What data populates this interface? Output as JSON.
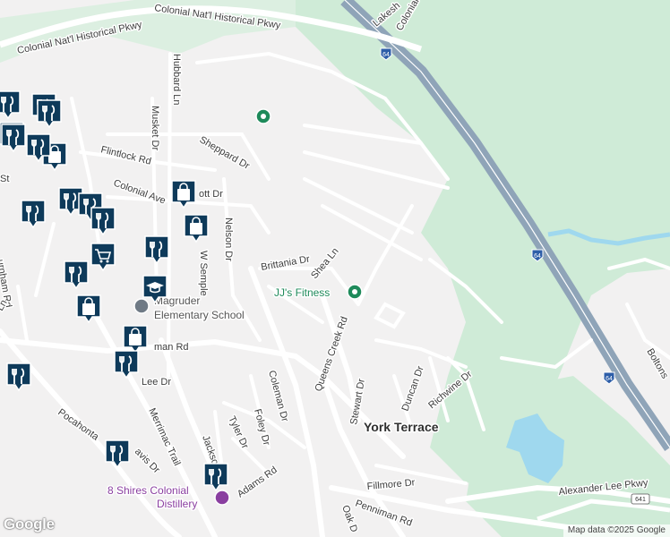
{
  "map": {
    "colors": {
      "background": "#f2f1f1",
      "park": "#cfebd7",
      "water": "#9fd8ee",
      "highway": "#8fa4b8",
      "road": "#ffffff",
      "pin": "#0e3a5a",
      "pin_border": "#ffffff"
    },
    "road_labels": {
      "colonial_1": "Colonial Nat'l Historical Pkwy",
      "colonial_2": "Colonial Nat'l Historical Pkwy",
      "lakeshore": "Lakesh",
      "colonial_short": "Colonial",
      "hubbard": "Hubbard Ln",
      "musket": "Musket Dr",
      "sheppard": "Sheppard Dr",
      "flintlock": "Flintlock Rd",
      "colonial_ave": "Colonial Ave",
      "ott": "ott Dr",
      "nelson": "Nelson Dr",
      "w_semple": "W Semple",
      "brittania": "Brittania Dr",
      "shea": "Shea Ln",
      "queens_creek": "Queens Creek Rd",
      "stewart": "Stewart Dr",
      "duncan": "Duncan Dr",
      "richwine": "Richwine Dr",
      "penniman_w": "man Rd",
      "lee": "Lee Dr",
      "coleman": "Coleman Dr",
      "foley": "Foley Dr",
      "tyler": "Tyler Dr",
      "jackson": "Jackson",
      "adams": "Adams Rd",
      "merrimac": "Merrimac Trail",
      "pocahontas": "Pocahonta",
      "davis": "avis Dr",
      "fillmore": "Fillmore Dr",
      "penniman_e": "Penniman Rd",
      "oak": "Oak D",
      "alexander": "Alexander Lee Pkwy",
      "boltons": "Boltons",
      "burnham": "urnham Rd",
      "ln": "Ln",
      "st": "St"
    },
    "shields": {
      "i64_top": "64",
      "i64_mid": "64",
      "i64_low": "64",
      "r641": "641"
    },
    "place_labels": {
      "york_terrace": "York Terrace"
    },
    "pois": {
      "jjs_fitness": "JJ's Fitness",
      "school_line1": "Magruder",
      "school_line2": "Elementary School",
      "distillery_line1": "8 Shires Colonial",
      "distillery_line2": "Distillery"
    },
    "pins": [
      {
        "type": "restaurant",
        "icon": "fork-knife-icon"
      },
      {
        "type": "restaurant",
        "icon": "fork-knife-icon"
      },
      {
        "type": "restaurant",
        "icon": "fork-knife-icon"
      },
      {
        "type": "restaurant",
        "icon": "fork-knife-icon"
      },
      {
        "type": "restaurant",
        "icon": "fork-knife-icon"
      },
      {
        "type": "shopping",
        "icon": "shopping-bag-icon"
      },
      {
        "type": "restaurant",
        "icon": "fork-knife-icon"
      },
      {
        "type": "restaurant",
        "icon": "fork-knife-icon"
      },
      {
        "type": "restaurant",
        "icon": "fork-knife-icon"
      },
      {
        "type": "restaurant",
        "icon": "fork-knife-icon"
      },
      {
        "type": "shopping",
        "icon": "shopping-bag-icon"
      },
      {
        "type": "shopping",
        "icon": "shopping-bag-icon"
      },
      {
        "type": "grocery",
        "icon": "shopping-cart-icon"
      },
      {
        "type": "restaurant",
        "icon": "fork-knife-icon"
      },
      {
        "type": "restaurant",
        "icon": "fork-knife-icon"
      },
      {
        "type": "school",
        "icon": "graduation-cap-icon"
      },
      {
        "type": "shopping",
        "icon": "shopping-bag-icon"
      },
      {
        "type": "shopping",
        "icon": "shopping-bag-icon"
      },
      {
        "type": "restaurant",
        "icon": "fork-knife-icon"
      },
      {
        "type": "restaurant",
        "icon": "fork-knife-icon"
      },
      {
        "type": "restaurant",
        "icon": "fork-knife-icon"
      },
      {
        "type": "restaurant",
        "icon": "fork-knife-icon"
      },
      {
        "type": "restaurant",
        "icon": "fork-knife-icon"
      }
    ],
    "branding": {
      "logo": "Google",
      "attribution": "Map data ©2025 Google"
    }
  }
}
